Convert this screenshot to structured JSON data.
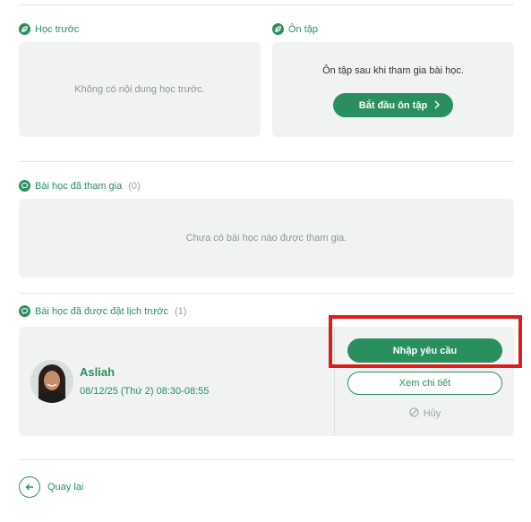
{
  "prelearn": {
    "title": "Học trước",
    "empty_text": "Không có nội dung học trước."
  },
  "review": {
    "title": "Ôn tập",
    "description": "Ôn tập sau khi tham gia bài học.",
    "start_label": "Bắt đầu ôn tập"
  },
  "attended": {
    "title": "Bài học đã tham gia",
    "count": "(0)",
    "empty_text": "Chưa có bài học nào được tham gia."
  },
  "scheduled": {
    "title": "Bài học đã được đặt lịch trước",
    "count": "(1)",
    "lesson": {
      "teacher_name": "Asliah",
      "datetime": "08/12/25 (Thứ 2) 08:30-08:55",
      "request_label": "Nhập yêu cầu",
      "detail_label": "Xem chi tiết",
      "cancel_label": "Hủy"
    }
  },
  "footer": {
    "back_label": "Quay lại"
  },
  "colors": {
    "accent": "#2a8f5f",
    "card_bg": "#f0f3f2",
    "highlight": "#e01b1b"
  },
  "icons": {
    "prelearn": "leaf-icon",
    "review": "leaf-icon",
    "attended": "chat-icon",
    "scheduled": "chat-icon",
    "cancel": "cancel-circle-icon",
    "back": "arrow-left-icon",
    "start_chevron": "chevron-right-icon"
  }
}
